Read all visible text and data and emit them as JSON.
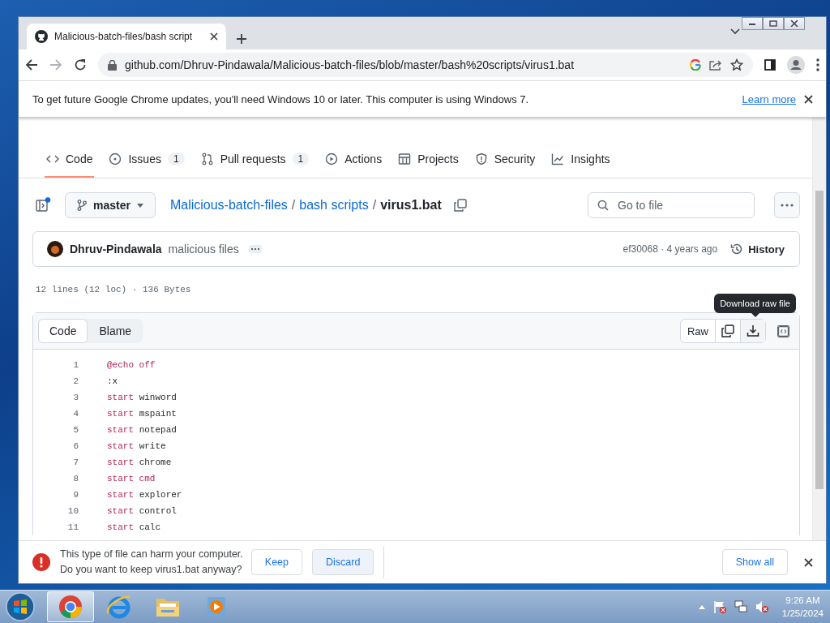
{
  "browser": {
    "tab_title": "Malicious-batch-files/bash script",
    "address": "github.com/Dhruv-Pindawala/Malicious-batch-files/blob/master/bash%20scripts/virus1.bat"
  },
  "infobar": {
    "message": "To get future Google Chrome updates, you'll need Windows 10 or later. This computer is using Windows 7.",
    "link": "Learn more"
  },
  "repo_nav": [
    {
      "kind": "code",
      "label": "Code",
      "selected": true
    },
    {
      "kind": "issues",
      "label": "Issues",
      "count": "1",
      "selected": false
    },
    {
      "kind": "pulls",
      "label": "Pull requests",
      "count": "1",
      "selected": false
    },
    {
      "kind": "actions",
      "label": "Actions",
      "selected": false
    },
    {
      "kind": "projects",
      "label": "Projects",
      "selected": false
    },
    {
      "kind": "security",
      "label": "Security",
      "selected": false
    },
    {
      "kind": "insights",
      "label": "Insights",
      "selected": false
    }
  ],
  "breadcrumb": {
    "branch": "master",
    "repo": "Malicious-batch-files",
    "separator_1": "/",
    "folder": "bash scripts",
    "separator_2": "/",
    "file": "virus1.bat"
  },
  "search": {
    "placeholder": "Go to file"
  },
  "commit": {
    "author": "Dhruv-Pindawala",
    "message": "malicious files",
    "sha_age": "ef30068 · 4 years ago",
    "history": "History"
  },
  "file_info": "12 lines (12 loc) · 136 Bytes",
  "view_tabs": [
    {
      "label": "Code",
      "selected": true
    },
    {
      "label": "Blame",
      "selected": false
    }
  ],
  "raw_button": "Raw",
  "tooltip": "Download raw file",
  "code_lines": [
    {
      "number": "1",
      "tokens": [
        {
          "kind": "keyword",
          "text": "@echo off"
        }
      ]
    },
    {
      "number": "2",
      "tokens": [
        {
          "kind": "plain",
          "text": ":x"
        }
      ]
    },
    {
      "number": "3",
      "tokens": [
        {
          "kind": "keyword",
          "text": "start"
        },
        {
          "kind": "plain",
          "text": "winword"
        }
      ]
    },
    {
      "number": "4",
      "tokens": [
        {
          "kind": "keyword",
          "text": "start"
        },
        {
          "kind": "plain",
          "text": "mspaint"
        }
      ]
    },
    {
      "number": "5",
      "tokens": [
        {
          "kind": "keyword",
          "text": "start"
        },
        {
          "kind": "plain",
          "text": "notepad"
        }
      ]
    },
    {
      "number": "6",
      "tokens": [
        {
          "kind": "keyword",
          "text": "start"
        },
        {
          "kind": "plain",
          "text": "write"
        }
      ]
    },
    {
      "number": "7",
      "tokens": [
        {
          "kind": "keyword",
          "text": "start"
        },
        {
          "kind": "plain",
          "text": "chrome"
        }
      ]
    },
    {
      "number": "8",
      "tokens": [
        {
          "kind": "keyword",
          "text": "start cmd"
        }
      ]
    },
    {
      "number": "9",
      "tokens": [
        {
          "kind": "keyword",
          "text": "start"
        },
        {
          "kind": "plain",
          "text": "explorer"
        }
      ]
    },
    {
      "number": "10",
      "tokens": [
        {
          "kind": "keyword",
          "text": "start"
        },
        {
          "kind": "plain",
          "text": "control"
        }
      ]
    },
    {
      "number": "11",
      "tokens": [
        {
          "kind": "keyword",
          "text": "start"
        },
        {
          "kind": "plain",
          "text": "calc"
        }
      ]
    }
  ],
  "download_bar": {
    "warning_lines": [
      "This type of file can harm your computer.",
      "Do you want to keep virus1.bat anyway?"
    ],
    "keep": "Keep",
    "discard": "Discard",
    "show_all": "Show all"
  },
  "taskbar": {
    "apps": [
      {
        "kind": "chrome",
        "selected": true
      },
      {
        "kind": "ie",
        "selected": false
      },
      {
        "kind": "explorer",
        "selected": false
      },
      {
        "kind": "media",
        "selected": false
      }
    ],
    "time": "9:26 AM",
    "date": "1/25/2024"
  }
}
